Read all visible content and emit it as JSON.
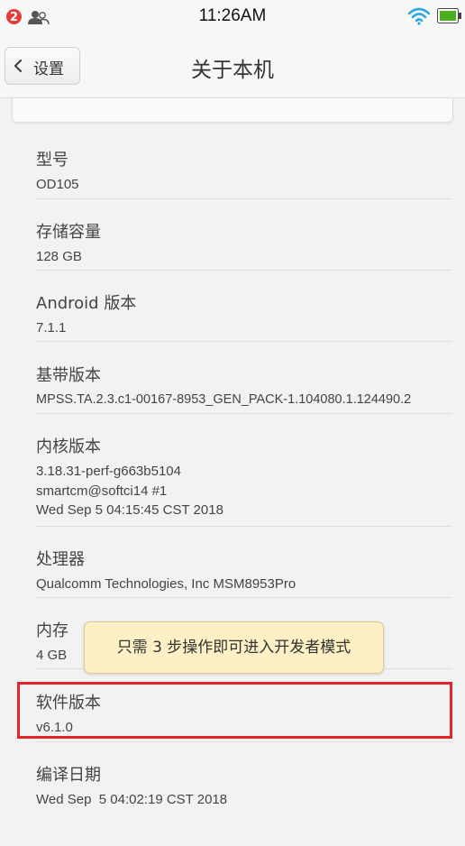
{
  "status_bar": {
    "notification_count": "2",
    "time": "11:26AM"
  },
  "header": {
    "back_label": "设置",
    "title": "关于本机"
  },
  "items": [
    {
      "label": "型号",
      "value": "OD105"
    },
    {
      "label": "存储容量",
      "value": "128 GB"
    },
    {
      "label": "Android 版本",
      "value": "7.1.1"
    },
    {
      "label": "基带版本",
      "value": "MPSS.TA.2.3.c1-00167-8953_GEN_PACK-1.104080.1.124490.2"
    },
    {
      "label": "内核版本",
      "value": "3.18.31-perf-g663b5104\nsmartcm@softci14 #1\nWed Sep 5 04:15:45 CST 2018"
    },
    {
      "label": "处理器",
      "value": "Qualcomm Technologies, Inc MSM8953Pro"
    },
    {
      "label": "内存",
      "value": "4 GB"
    },
    {
      "label": "软件版本",
      "value": "v6.1.0"
    },
    {
      "label": "编译日期",
      "value": "Wed Sep  5 04:02:19 CST 2018"
    }
  ],
  "toast": {
    "message": "只需 3 步操作即可进入开发者模式"
  },
  "colors": {
    "highlight": "#e0262a",
    "badge": "#e63c3c",
    "wifi": "#2aa8e0",
    "battery": "#4caf1e",
    "toast_bg": "#fdf0c4"
  }
}
